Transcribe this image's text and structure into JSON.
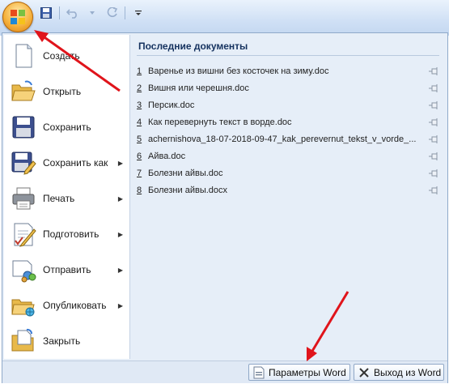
{
  "qat": {
    "save_icon": "save-icon",
    "undo_icon": "undo-icon",
    "redo_icon": "redo-icon"
  },
  "menu_items": [
    {
      "label": "Создать",
      "icon": "new-document-icon",
      "has_submenu": false
    },
    {
      "label": "Открыть",
      "icon": "open-folder-icon",
      "has_submenu": false
    },
    {
      "label": "Сохранить",
      "icon": "save-icon",
      "has_submenu": false
    },
    {
      "label": "Сохранить как",
      "icon": "save-as-icon",
      "has_submenu": true
    },
    {
      "label": "Печать",
      "icon": "printer-icon",
      "has_submenu": true
    },
    {
      "label": "Подготовить",
      "icon": "prepare-icon",
      "has_submenu": true
    },
    {
      "label": "Отправить",
      "icon": "send-icon",
      "has_submenu": true
    },
    {
      "label": "Опубликовать",
      "icon": "publish-icon",
      "has_submenu": true
    },
    {
      "label": "Закрыть",
      "icon": "close-document-icon",
      "has_submenu": false
    }
  ],
  "recent": {
    "title": "Последние документы",
    "docs": [
      {
        "num": "1",
        "name": "Варенье из вишни без косточек на зиму.doc"
      },
      {
        "num": "2",
        "name": "Вишня или черешня.doc"
      },
      {
        "num": "3",
        "name": "Персик.doc"
      },
      {
        "num": "4",
        "name": "Как перевернуть текст в ворде.doc"
      },
      {
        "num": "5",
        "name": "achernishova_18-07-2018-09-47_kak_perevernut_tekst_v_vorde_..."
      },
      {
        "num": "6",
        "name": "Айва.doc"
      },
      {
        "num": "7",
        "name": "Болезни айвы.doc"
      },
      {
        "num": "8",
        "name": "Болезни айвы.docx"
      }
    ]
  },
  "bottom": {
    "options_label": "Параметры Word",
    "exit_label": "Выход из Word"
  },
  "colors": {
    "annotation_arrow": "#e0141b",
    "accent_orb": "#f5b13c"
  }
}
